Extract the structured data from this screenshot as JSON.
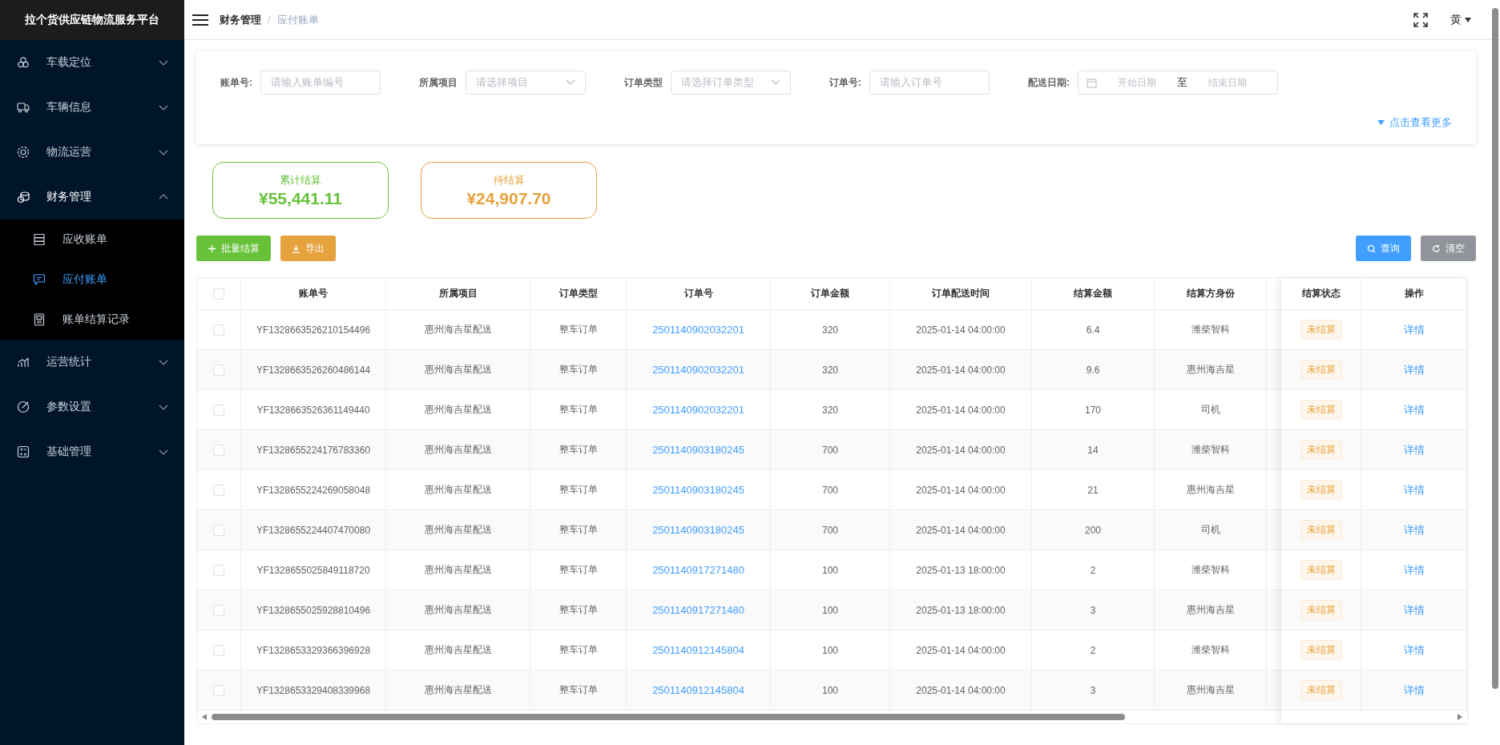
{
  "sidebar": {
    "title": "拉个货供应链物流服务平台",
    "items": [
      {
        "label": "车载定位",
        "expanded": false
      },
      {
        "label": "车辆信息",
        "expanded": false
      },
      {
        "label": "物流运营",
        "expanded": false
      },
      {
        "label": "财务管理",
        "expanded": true,
        "children": [
          {
            "label": "应收账单",
            "selected": false
          },
          {
            "label": "应付账单",
            "selected": true
          },
          {
            "label": "账单结算记录",
            "selected": false
          }
        ]
      },
      {
        "label": "运营统计",
        "expanded": false
      },
      {
        "label": "参数设置",
        "expanded": false
      },
      {
        "label": "基础管理",
        "expanded": false
      }
    ]
  },
  "header": {
    "breadcrumb": [
      "财务管理",
      "应付账单"
    ],
    "breadcrumb_separator": "/",
    "user": "黄"
  },
  "filters": [
    {
      "kind": "input",
      "label": "账单号:",
      "placeholder": "请输入账单编号"
    },
    {
      "kind": "select",
      "label": "所属项目",
      "placeholder": "请选择项目"
    },
    {
      "kind": "select",
      "label": "订单类型",
      "placeholder": "请选择订单类型"
    },
    {
      "kind": "input",
      "label": "订单号:",
      "placeholder": "请输入订单号"
    },
    {
      "kind": "daterange",
      "label": "配送日期:",
      "start_placeholder": "开始日期",
      "separator": "至",
      "end_placeholder": "结束日期"
    }
  ],
  "more_link": "点击查看更多",
  "stats": [
    {
      "label": "累计结算",
      "value": "¥55,441.11",
      "color": "#67c23a"
    },
    {
      "label": "待结算",
      "value": "¥24,907.70",
      "color": "#e6a23c"
    }
  ],
  "actions": [
    {
      "kind": "batch",
      "label": "批量结算"
    },
    {
      "kind": "export",
      "label": "导出"
    },
    {
      "kind": "query",
      "label": "查询"
    },
    {
      "kind": "clear",
      "label": "清空"
    }
  ],
  "table": {
    "select_all_checked": false,
    "columns": [
      "账单号",
      "所属项目",
      "订单类型",
      "订单号",
      "订单金额",
      "订单配送时间",
      "结算金额",
      "结算方身份",
      "结算状态",
      "操作"
    ],
    "rows": [
      {
        "checked": false,
        "cells": [
          "YF1328663526210154496",
          "惠州海吉星配送",
          "整车订单",
          "2501140902032201",
          "320",
          "2025-01-14 04:00:00",
          "6.4",
          "潍柴智科",
          "未结算",
          "详情"
        ]
      },
      {
        "checked": false,
        "cells": [
          "YF1328663526260486144",
          "惠州海吉星配送",
          "整车订单",
          "2501140902032201",
          "320",
          "2025-01-14 04:00:00",
          "9.6",
          "惠州海吉星",
          "未结算",
          "详情"
        ]
      },
      {
        "checked": false,
        "cells": [
          "YF1328663526361149440",
          "惠州海吉星配送",
          "整车订单",
          "2501140902032201",
          "320",
          "2025-01-14 04:00:00",
          "170",
          "司机",
          "未结算",
          "详情"
        ]
      },
      {
        "checked": false,
        "cells": [
          "YF1328655224176783360",
          "惠州海吉星配送",
          "整车订单",
          "2501140903180245",
          "700",
          "2025-01-14 04:00:00",
          "14",
          "潍柴智科",
          "未结算",
          "详情"
        ]
      },
      {
        "checked": false,
        "cells": [
          "YF1328655224269058048",
          "惠州海吉星配送",
          "整车订单",
          "2501140903180245",
          "700",
          "2025-01-14 04:00:00",
          "21",
          "惠州海吉星",
          "未结算",
          "详情"
        ]
      },
      {
        "checked": false,
        "cells": [
          "YF1328655224407470080",
          "惠州海吉星配送",
          "整车订单",
          "2501140903180245",
          "700",
          "2025-01-14 04:00:00",
          "200",
          "司机",
          "未结算",
          "详情"
        ]
      },
      {
        "checked": false,
        "cells": [
          "YF1328655025849118720",
          "惠州海吉星配送",
          "整车订单",
          "2501140917271480",
          "100",
          "2025-01-13 18:00:00",
          "2",
          "潍柴智科",
          "未结算",
          "详情"
        ]
      },
      {
        "checked": false,
        "cells": [
          "YF1328655025928810496",
          "惠州海吉星配送",
          "整车订单",
          "2501140917271480",
          "100",
          "2025-01-13 18:00:00",
          "3",
          "惠州海吉星",
          "未结算",
          "详情"
        ]
      },
      {
        "checked": false,
        "cells": [
          "YF1328653329366396928",
          "惠州海吉星配送",
          "整车订单",
          "2501140912145804",
          "100",
          "2025-01-14 04:00:00",
          "2",
          "潍柴智科",
          "未结算",
          "详情"
        ]
      },
      {
        "checked": false,
        "cells": [
          "YF1328653329408339968",
          "惠州海吉星配送",
          "整车订单",
          "2501140912145804",
          "100",
          "2025-01-14 04:00:00",
          "3",
          "惠州海吉星",
          "未结算",
          "详情"
        ]
      }
    ]
  }
}
